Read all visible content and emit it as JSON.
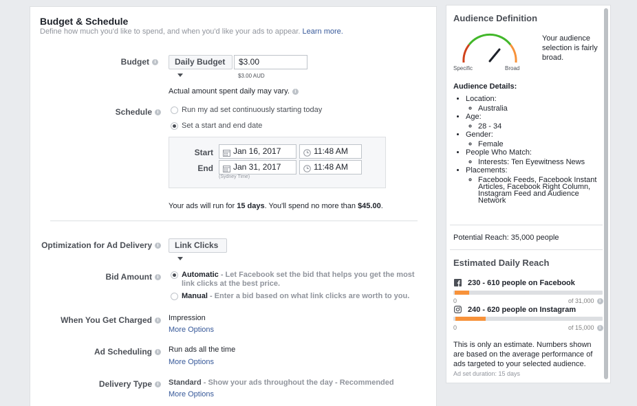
{
  "budget_schedule": {
    "title": "Budget & Schedule",
    "subtitle": "Define how much you'd like to spend, and when you'd like your ads to appear.",
    "learn_more": "Learn more.",
    "budget_label": "Budget",
    "budget_type": "Daily Budget",
    "budget_value": "$3.00",
    "budget_currency_note": "$3.00 AUD",
    "budget_note": "Actual amount spent daily may vary.",
    "schedule_label": "Schedule",
    "schedule_option_1": "Run my ad set continuously starting today",
    "schedule_option_2": "Set a start and end date",
    "start_label": "Start",
    "end_label": "End",
    "start_date": "Jan 16, 2017",
    "start_time": "11:48 AM",
    "end_date": "Jan 31, 2017",
    "end_time": "11:48 AM",
    "timezone": "(Sydney Time)",
    "run_summary_prefix": "Your ads will run for ",
    "run_days": "15 days",
    "run_summary_mid": ". You'll spend no more than ",
    "run_amount": "$45.00",
    "run_summary_suffix": "."
  },
  "delivery": {
    "optimization_label": "Optimization for Ad Delivery",
    "optimization_value": "Link Clicks",
    "bid_label": "Bid Amount",
    "bid_auto_title": "Automatic",
    "bid_auto_desc_1": " - Let Facebook set the bid that helps you get the most",
    "bid_auto_desc_2": "link clicks at the best price.",
    "bid_manual_title": "Manual",
    "bid_manual_desc": " - Enter a bid based on what link clicks are worth to you.",
    "charged_label": "When You Get Charged",
    "charged_value": "Impression",
    "more_options": "More Options",
    "scheduling_label": "Ad Scheduling",
    "scheduling_value": "Run ads all the time",
    "delivery_type_label": "Delivery Type",
    "delivery_type_title": "Standard",
    "delivery_type_desc": " - Show your ads throughout the day - Recommended"
  },
  "audience": {
    "title": "Audience Definition",
    "gauge_left": "Specific",
    "gauge_right": "Broad",
    "gauge_level": 0.72,
    "summary": "Your audience selection is fairly broad.",
    "details_title": "Audience Details:",
    "details": [
      {
        "label": "Location:",
        "values": [
          "Australia"
        ]
      },
      {
        "label": "Age:",
        "values": [
          "28 - 34"
        ]
      },
      {
        "label": "Gender:",
        "values": [
          "Female"
        ]
      },
      {
        "label": "People Who Match:",
        "values": [
          "Interests: Ten Eyewitness News"
        ]
      },
      {
        "label": "Placements:",
        "values": [
          "Facebook Feeds, Facebook Instant Articles, Facebook Right Column, Instagram Feed and Audience Network"
        ]
      }
    ],
    "potential_reach": "Potential Reach: 35,000 people"
  },
  "daily_reach": {
    "title": "Estimated Daily Reach",
    "facebook": {
      "text": "230 - 610 people on Facebook",
      "min": "0",
      "max": "of 31,000",
      "low": 230,
      "high": 610,
      "total": 31000
    },
    "instagram": {
      "text": "240 - 620 people on Instagram",
      "min": "0",
      "max": "of 15,000",
      "low": 240,
      "high": 620,
      "total": 15000
    },
    "note": "This is only an estimate. Numbers shown are based on the average performance of ads targeted to your selected audience.",
    "duration": "Ad set duration: 15 days"
  },
  "colors": {
    "link": "#365899",
    "accent": "#f7923a",
    "gauge_green": "#42b72a",
    "gauge_red": "#d0421b",
    "gauge_orange": "#f7923a"
  },
  "icons": {
    "info": "info-icon",
    "calendar": "calendar-icon",
    "clock": "clock-icon",
    "facebook": "facebook-icon",
    "instagram": "instagram-icon",
    "caret": "caret-down-icon"
  }
}
